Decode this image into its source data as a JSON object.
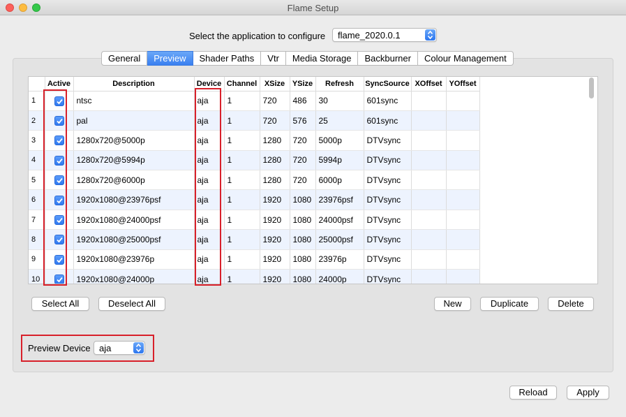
{
  "window": {
    "title": "Flame Setup"
  },
  "app_select": {
    "label": "Select the application to configure",
    "value": "flame_2020.0.1"
  },
  "tabs": [
    {
      "label": "General",
      "active": false
    },
    {
      "label": "Preview",
      "active": true
    },
    {
      "label": "Shader Paths",
      "active": false
    },
    {
      "label": "Vtr",
      "active": false
    },
    {
      "label": "Media Storage",
      "active": false
    },
    {
      "label": "Backburner",
      "active": false
    },
    {
      "label": "Colour Management",
      "active": false
    }
  ],
  "table": {
    "columns": [
      "",
      "Active",
      "Description",
      "Device",
      "Channel",
      "XSize",
      "YSize",
      "Refresh",
      "SyncSource",
      "XOffset",
      "YOffset"
    ],
    "rows": [
      {
        "n": "1",
        "active": true,
        "description": "ntsc",
        "device": "aja",
        "channel": "1",
        "xsize": "720",
        "ysize": "486",
        "refresh": "30",
        "sync": "601sync",
        "xoffset": "",
        "yoffset": ""
      },
      {
        "n": "2",
        "active": true,
        "description": "pal",
        "device": "aja",
        "channel": "1",
        "xsize": "720",
        "ysize": "576",
        "refresh": "25",
        "sync": "601sync",
        "xoffset": "",
        "yoffset": ""
      },
      {
        "n": "3",
        "active": true,
        "description": "1280x720@5000p",
        "device": "aja",
        "channel": "1",
        "xsize": "1280",
        "ysize": "720",
        "refresh": "5000p",
        "sync": "DTVsync",
        "xoffset": "",
        "yoffset": ""
      },
      {
        "n": "4",
        "active": true,
        "description": "1280x720@5994p",
        "device": "aja",
        "channel": "1",
        "xsize": "1280",
        "ysize": "720",
        "refresh": "5994p",
        "sync": "DTVsync",
        "xoffset": "",
        "yoffset": ""
      },
      {
        "n": "5",
        "active": true,
        "description": "1280x720@6000p",
        "device": "aja",
        "channel": "1",
        "xsize": "1280",
        "ysize": "720",
        "refresh": "6000p",
        "sync": "DTVsync",
        "xoffset": "",
        "yoffset": ""
      },
      {
        "n": "6",
        "active": true,
        "description": "1920x1080@23976psf",
        "device": "aja",
        "channel": "1",
        "xsize": "1920",
        "ysize": "1080",
        "refresh": "23976psf",
        "sync": "DTVsync",
        "xoffset": "",
        "yoffset": ""
      },
      {
        "n": "7",
        "active": true,
        "description": "1920x1080@24000psf",
        "device": "aja",
        "channel": "1",
        "xsize": "1920",
        "ysize": "1080",
        "refresh": "24000psf",
        "sync": "DTVsync",
        "xoffset": "",
        "yoffset": ""
      },
      {
        "n": "8",
        "active": true,
        "description": "1920x1080@25000psf",
        "device": "aja",
        "channel": "1",
        "xsize": "1920",
        "ysize": "1080",
        "refresh": "25000psf",
        "sync": "DTVsync",
        "xoffset": "",
        "yoffset": ""
      },
      {
        "n": "9",
        "active": true,
        "description": "1920x1080@23976p",
        "device": "aja",
        "channel": "1",
        "xsize": "1920",
        "ysize": "1080",
        "refresh": "23976p",
        "sync": "DTVsync",
        "xoffset": "",
        "yoffset": ""
      },
      {
        "n": "10",
        "active": true,
        "description": "1920x1080@24000p",
        "device": "aja",
        "channel": "1",
        "xsize": "1920",
        "ysize": "1080",
        "refresh": "24000p",
        "sync": "DTVsync",
        "xoffset": "",
        "yoffset": ""
      }
    ]
  },
  "buttons": {
    "select_all": "Select All",
    "deselect_all": "Deselect All",
    "new": "New",
    "duplicate": "Duplicate",
    "delete": "Delete",
    "reload": "Reload",
    "apply": "Apply"
  },
  "preview_device": {
    "label": "Preview Device",
    "value": "aja"
  },
  "colors": {
    "accent": "#3a80f0",
    "highlight": "#d8202a",
    "row_alt": "#edf3fe"
  }
}
